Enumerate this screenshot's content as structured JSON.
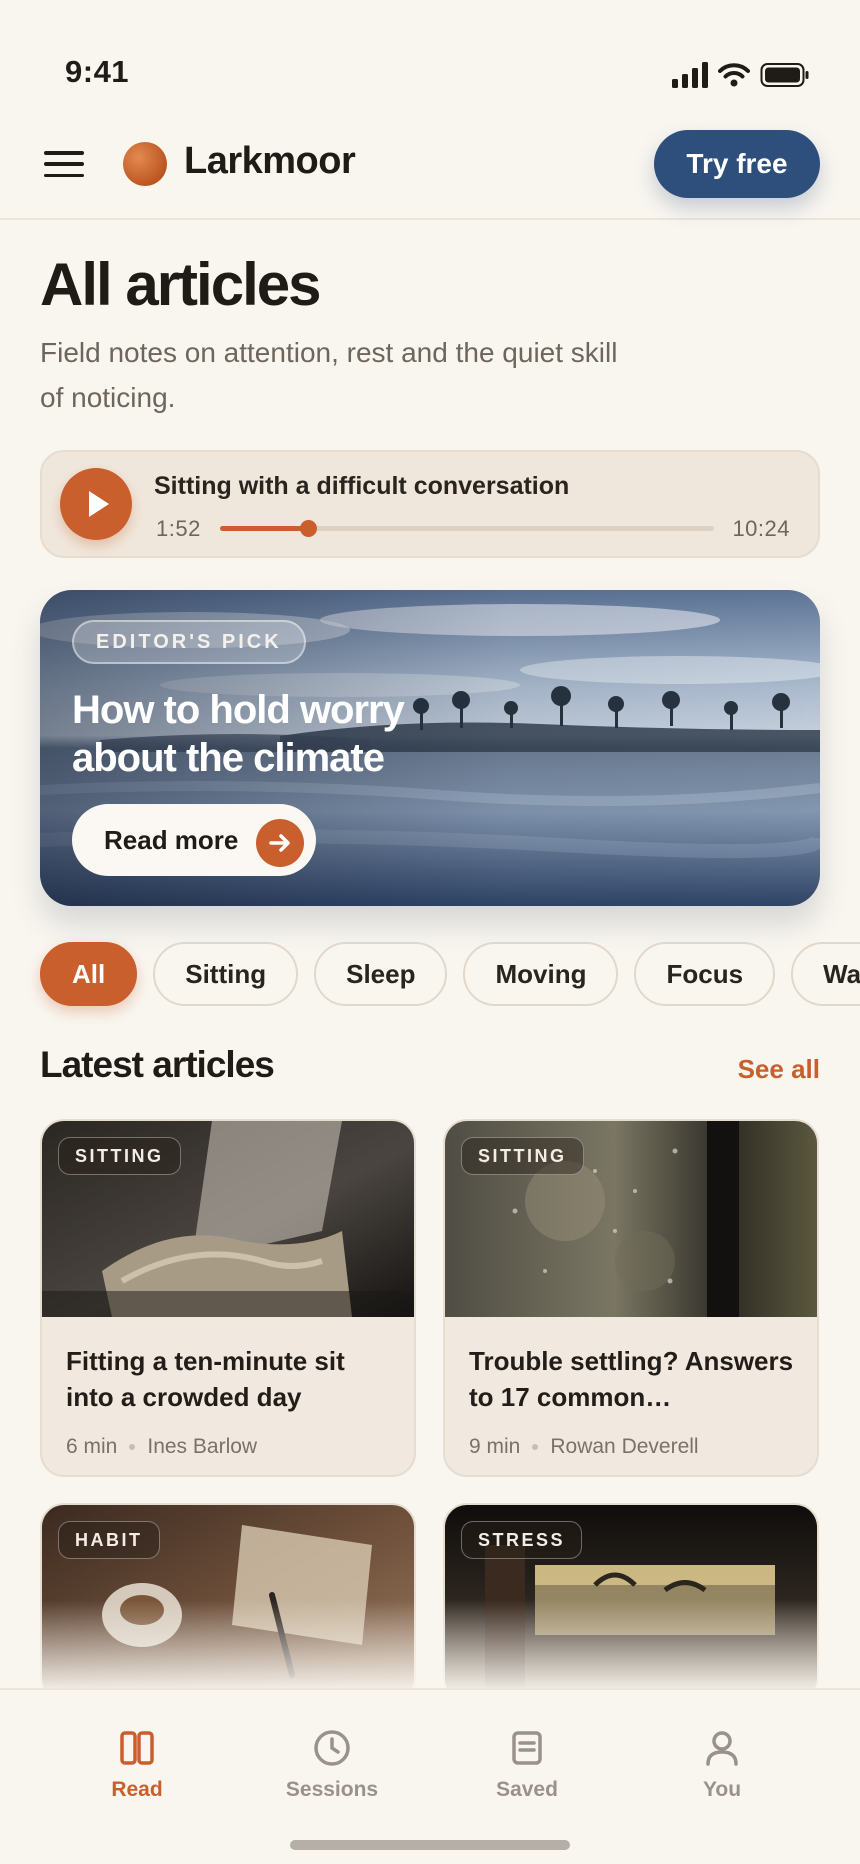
{
  "status_bar": {
    "time": "9:41"
  },
  "header": {
    "brand": "Larkmoor",
    "cta_label": "Try free"
  },
  "page": {
    "title": "All articles",
    "subtitle": "Field notes on attention, rest and the quiet skill of noticing."
  },
  "player": {
    "title": "Sitting with a difficult conversation",
    "current_time": "1:52",
    "total_time": "10:24",
    "progress": 0.179
  },
  "hero": {
    "badge": "EDITOR'S PICK",
    "title": "How to hold worry about the climate",
    "button_label": "Read more"
  },
  "filters": {
    "items": [
      {
        "label": "All",
        "active": true
      },
      {
        "label": "Sitting",
        "active": false
      },
      {
        "label": "Sleep",
        "active": false
      },
      {
        "label": "Moving",
        "active": false
      },
      {
        "label": "Focus",
        "active": false
      },
      {
        "label": "Wa",
        "active": false
      }
    ]
  },
  "latest": {
    "heading": "Latest articles",
    "see_all": "See all",
    "cards": [
      {
        "badge": "SITTING",
        "title": "Fitting a ten-minute sit into a crowded day",
        "duration": "6 min",
        "author": "Ines Barlow"
      },
      {
        "badge": "SITTING",
        "title": "Trouble settling? Answers to 17 common…",
        "duration": "9 min",
        "author": "Rowan Deverell"
      },
      {
        "badge": "HABIT"
      },
      {
        "badge": "STRESS"
      }
    ]
  },
  "tabbar": {
    "items": [
      {
        "label": "Read",
        "icon": "book-icon",
        "active": true
      },
      {
        "label": "Sessions",
        "icon": "clock-icon",
        "active": false
      },
      {
        "label": "Saved",
        "icon": "document-icon",
        "active": false
      },
      {
        "label": "You",
        "icon": "person-icon",
        "active": false
      }
    ]
  },
  "colors": {
    "accent": "#c85f2d",
    "primary_button": "#2e4f7c",
    "background": "#f9f6f0",
    "card": "#f1e9df"
  }
}
